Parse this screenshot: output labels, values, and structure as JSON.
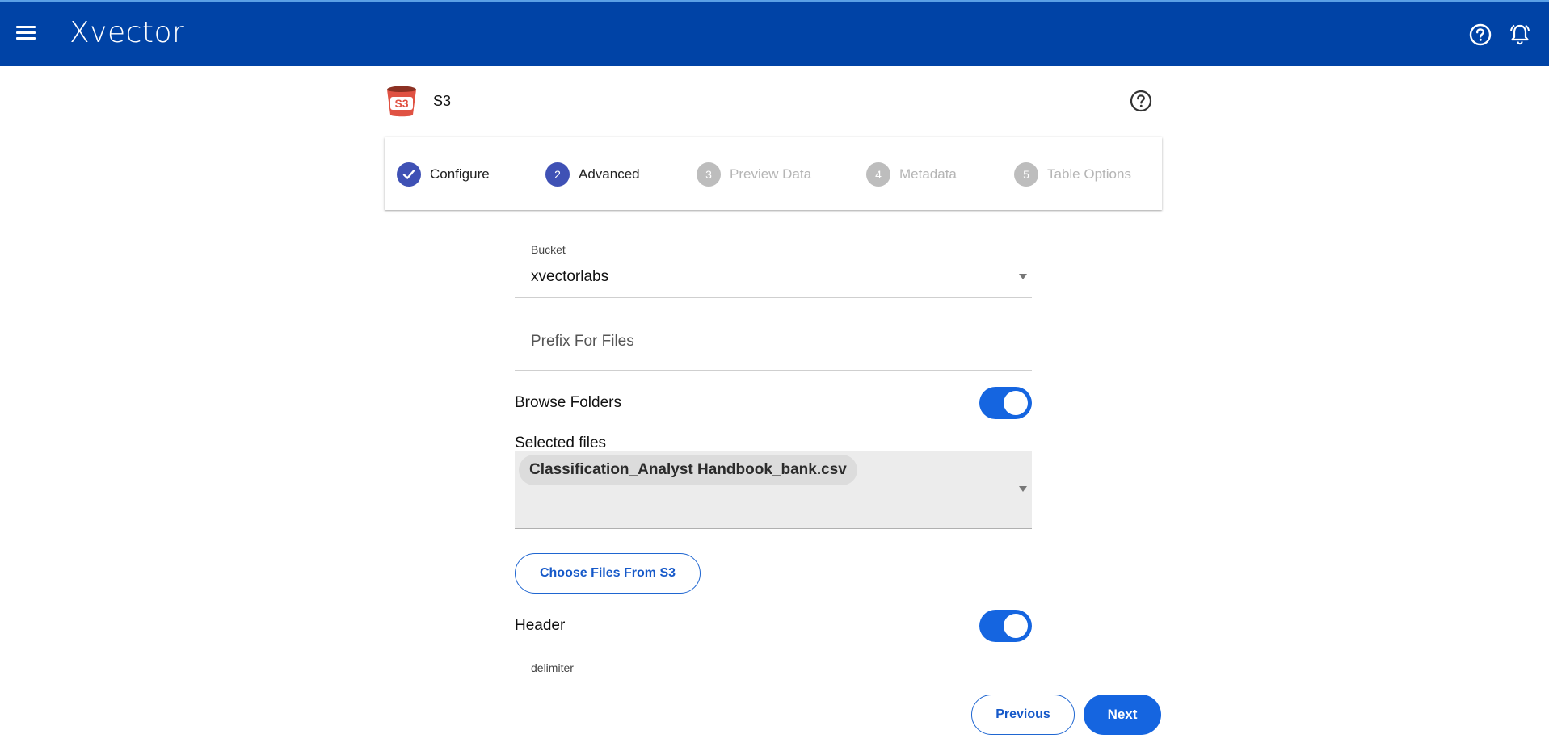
{
  "app": {
    "brand": "Xvector",
    "icons": {
      "menu": "hamburger-menu-icon",
      "help": "help-circle-icon",
      "notifications": "bell-icon"
    },
    "colors": {
      "appbar": "#0043a6",
      "accent": "#1565e0",
      "step_active": "#3f51b5",
      "step_inactive": "#bdbdbd"
    }
  },
  "source": {
    "name": "S3",
    "icon_text": "S3",
    "icon": "s3-bucket-icon"
  },
  "stepper": {
    "steps": [
      {
        "number": "1",
        "label": "Configure",
        "state": "completed"
      },
      {
        "number": "2",
        "label": "Advanced",
        "state": "active"
      },
      {
        "number": "3",
        "label": "Preview Data",
        "state": "inactive"
      },
      {
        "number": "4",
        "label": "Metadata",
        "state": "inactive"
      },
      {
        "number": "5",
        "label": "Table Options",
        "state": "inactive"
      }
    ]
  },
  "form": {
    "bucket": {
      "label": "Bucket",
      "value": "xvectorlabs"
    },
    "prefix": {
      "placeholder": "Prefix For Files",
      "value": ""
    },
    "browse_folders": {
      "label": "Browse Folders",
      "enabled": true
    },
    "selected_files": {
      "label": "Selected files",
      "files": [
        "Classification_Analyst Handbook_bank.csv"
      ]
    },
    "choose_files_button": "Choose Files From S3",
    "header": {
      "label": "Header",
      "enabled": true
    },
    "delimiter": {
      "label": "delimiter"
    }
  },
  "actions": {
    "previous": "Previous",
    "next": "Next"
  }
}
